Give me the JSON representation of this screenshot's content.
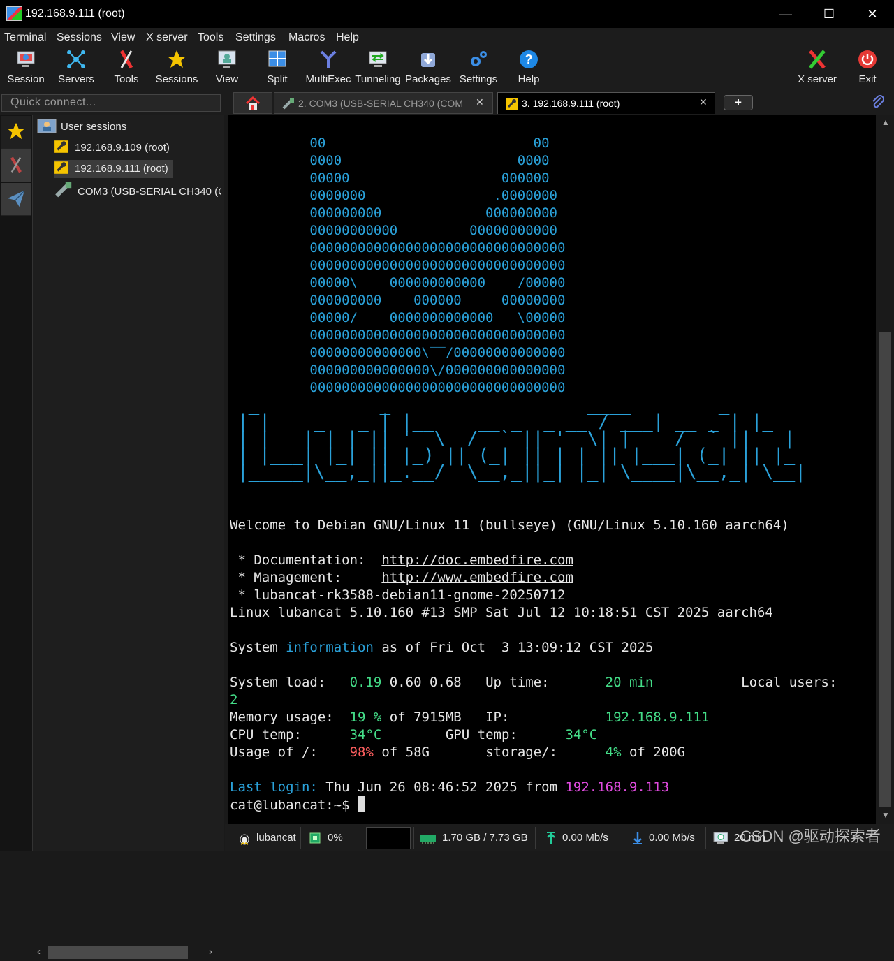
{
  "window": {
    "title": "192.168.9.111 (root)",
    "minimize": "—",
    "maximize": "☐",
    "close": "✕"
  },
  "menu": [
    "Terminal",
    "Sessions",
    "View",
    "X server",
    "Tools",
    "Settings",
    "Macros",
    "Help"
  ],
  "toolbar": {
    "session": "Session",
    "servers": "Servers",
    "tools": "Tools",
    "sessions": "Sessions",
    "view": "View",
    "split": "Split",
    "multiexec": "MultiExec",
    "tunneling": "Tunneling",
    "packages": "Packages",
    "settings": "Settings",
    "help": "Help",
    "xserver": "X server",
    "exit": "Exit"
  },
  "quick_connect": {
    "placeholder": "Quick connect..."
  },
  "tabs": {
    "tab2": "2. COM3  (USB-SERIAL CH340 (COM",
    "tab3": "3. 192.168.9.111 (root)",
    "add": "+"
  },
  "sidebar": {
    "root": "User sessions",
    "items": [
      "192.168.9.109 (root)",
      "192.168.9.111 (root)",
      "COM3  (USB-SERIAL CH340 (CO"
    ]
  },
  "terminal": {
    "art": [
      "          00                          00",
      "          0000                      0000",
      "          00000                   000000",
      "          0000000                .0000000",
      "          000000000             000000000",
      "          00000000000         00000000000",
      "          00000000000000000000000000000000",
      "          00000000000000000000000000000000",
      "          00000\\    000000000000    /00000",
      "          000000000    000000     00000000",
      "          00000/    0000000000000   \\00000",
      "          00000000000000000000000000000000",
      "          00000000000000\\‾‾/00000000000000",
      "          000000000000000\\/000000000000000",
      "          00000000000000000000000000000000"
    ],
    "logo": [
      " _           _                  ____        _",
      "| |    _   _ | |__    __ _  _ __ / ___| __ _ | |_",
      "| |   | | | || '_ \\  / _` || '_ \\| |    / _` || __|",
      "| |___| |_| || |_) || (_| || | | || |___| (_| || |_",
      "|_____|\\__,_||_.__/  \\__,_||_| |_| \\____|\\__,_| \\__|"
    ],
    "welcome": "Welcome to Debian GNU/Linux 11 (bullseye) (GNU/Linux 5.10.160 aarch64)",
    "doc_label": " * Documentation:  ",
    "doc_url": "http://doc.embedfire.com",
    "mgmt_label": " * Management:     ",
    "mgmt_url": "http://www.embedfire.com",
    "image": " * lubancat-rk3588-debian11-gnome-20250712",
    "uname": "Linux lubancat 5.10.160 #13 SMP Sat Jul 12 10:18:51 CST 2025 aarch64",
    "sysinfo_a": "System ",
    "sysinfo_b": "information",
    "sysinfo_c": " as of Fri Oct  3 13:09:12 CST 2025",
    "load_label": "System load:   ",
    "load_v1": "0.19",
    "load_rest": " 0.60 0.68   Up time:       ",
    "uptime": "20 min",
    "users_label": "           Local users:",
    "users": "2",
    "mem_label": "Memory usage:  ",
    "mem_pct": "19 %",
    "mem_rest": " of 7915MB   IP:            ",
    "ip": "192.168.9.111",
    "cpu_label": "CPU temp:      ",
    "cpu_temp": "34°C",
    "cpu_rest": "        GPU temp:      ",
    "gpu_temp": "34°C",
    "usage_label": "Usage of /:    ",
    "usage_pct": "98%",
    "usage_rest": " of 58G       storage/:      ",
    "storage_pct": "4%",
    "storage_rest": " of 200G",
    "lastlogin_label": "Last login:",
    "lastlogin_rest": " Thu Jun 26 08:46:52 2025 from ",
    "lastlogin_ip": "192.168.9.113",
    "prompt": "cat@lubancat:~$ "
  },
  "status": {
    "host": "lubancat",
    "cpu": "0%",
    "memory": "1.70 GB / 7.73 GB",
    "upload": "0.00 Mb/s",
    "download": "0.00 Mb/s",
    "uptime": "20 min"
  },
  "watermark": "CSDN @驱动探索者",
  "colors": {
    "accent": "#2aa1d9",
    "value_green": "#44dd88",
    "value_red": "#ff5f5f",
    "ip_pink": "#e14be0"
  }
}
